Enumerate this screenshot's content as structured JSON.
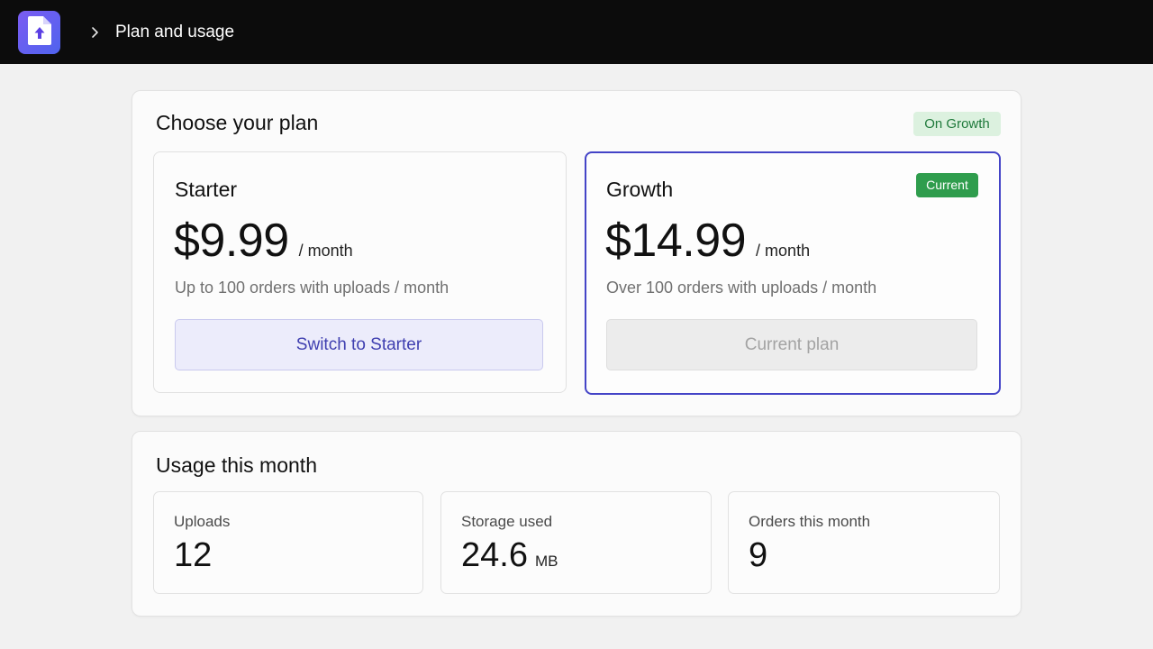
{
  "header": {
    "breadcrumb_title": "Plan and usage",
    "logo_icon": "upload-file-icon",
    "chevron_icon": "chevron-right-icon"
  },
  "plans_section": {
    "title": "Choose your plan",
    "status_badge": "On Growth",
    "plans": [
      {
        "name": "Starter",
        "price": "$9.99",
        "period": "/ month",
        "description": "Up to 100 orders with uploads / month",
        "button_label": "Switch to Starter"
      },
      {
        "name": "Growth",
        "price": "$14.99",
        "period": "/ month",
        "description": "Over 100 orders with uploads / month",
        "badge": "Current",
        "button_label": "Current plan"
      }
    ]
  },
  "usage_section": {
    "title": "Usage this month",
    "stats": [
      {
        "label": "Uploads",
        "value": "12",
        "unit": ""
      },
      {
        "label": "Storage used",
        "value": "24.6",
        "unit": "MB"
      },
      {
        "label": "Orders this month",
        "value": "9",
        "unit": ""
      }
    ]
  },
  "colors": {
    "accent": "#4444c7",
    "success": "#2f9d4d",
    "status_badge_bg": "#dcf1df",
    "topbar": "#0c0c0c"
  }
}
